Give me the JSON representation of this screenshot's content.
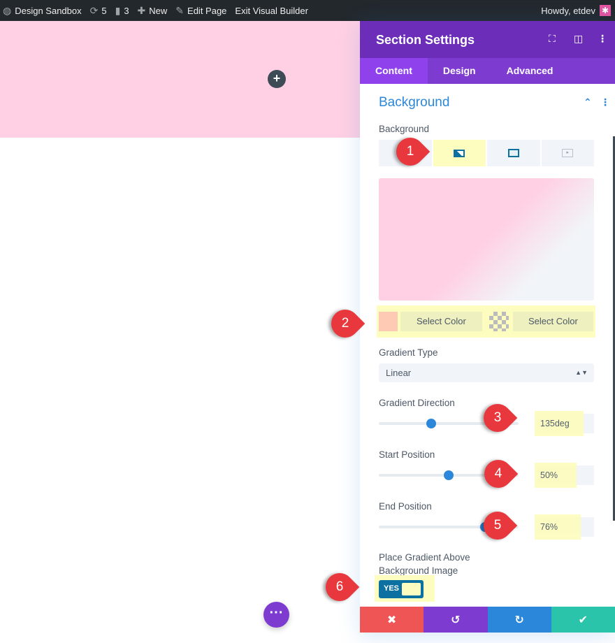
{
  "adminbar": {
    "site": "Design Sandbox",
    "updates": "5",
    "comments": "3",
    "new": "New",
    "edit": "Edit Page",
    "exit": "Exit Visual Builder",
    "howdy": "Howdy, etdev"
  },
  "panel": {
    "title": "Section Settings",
    "tabs": [
      "Content",
      "Design",
      "Advanced"
    ],
    "active_tab": "Content",
    "section_title": "Background",
    "background_label": "Background",
    "bg_types": [
      "color",
      "gradient",
      "image",
      "video"
    ],
    "active_bg_type": "gradient",
    "gradient": {
      "start_color": "#ffcab4",
      "select_color_1": "Select Color",
      "select_color_2": "Select Color",
      "type_label": "Gradient Type",
      "type_value": "Linear",
      "direction_label": "Gradient Direction",
      "direction_value": "135deg",
      "direction_fraction": 0.375,
      "start_label": "Start Position",
      "start_value": "50%",
      "start_fraction": 0.5,
      "end_label": "End Position",
      "end_value": "76%",
      "end_fraction": 0.76,
      "above_label_1": "Place Gradient Above",
      "above_label_2": "Background Image",
      "above_toggle": "YES"
    }
  },
  "footer": [
    "discard",
    "undo",
    "redo",
    "save"
  ],
  "markers": [
    "1",
    "2",
    "3",
    "4",
    "5",
    "6"
  ],
  "colors": {
    "header": "#6c2eb9",
    "tabs": "#7e3bd0",
    "accent": "#2b87da",
    "discard": "#ef5555",
    "undo": "#7e3bd0",
    "redo": "#2b87da",
    "save": "#29c4a9",
    "marker": "#e8383d",
    "highlight": "#fdfdc0"
  }
}
